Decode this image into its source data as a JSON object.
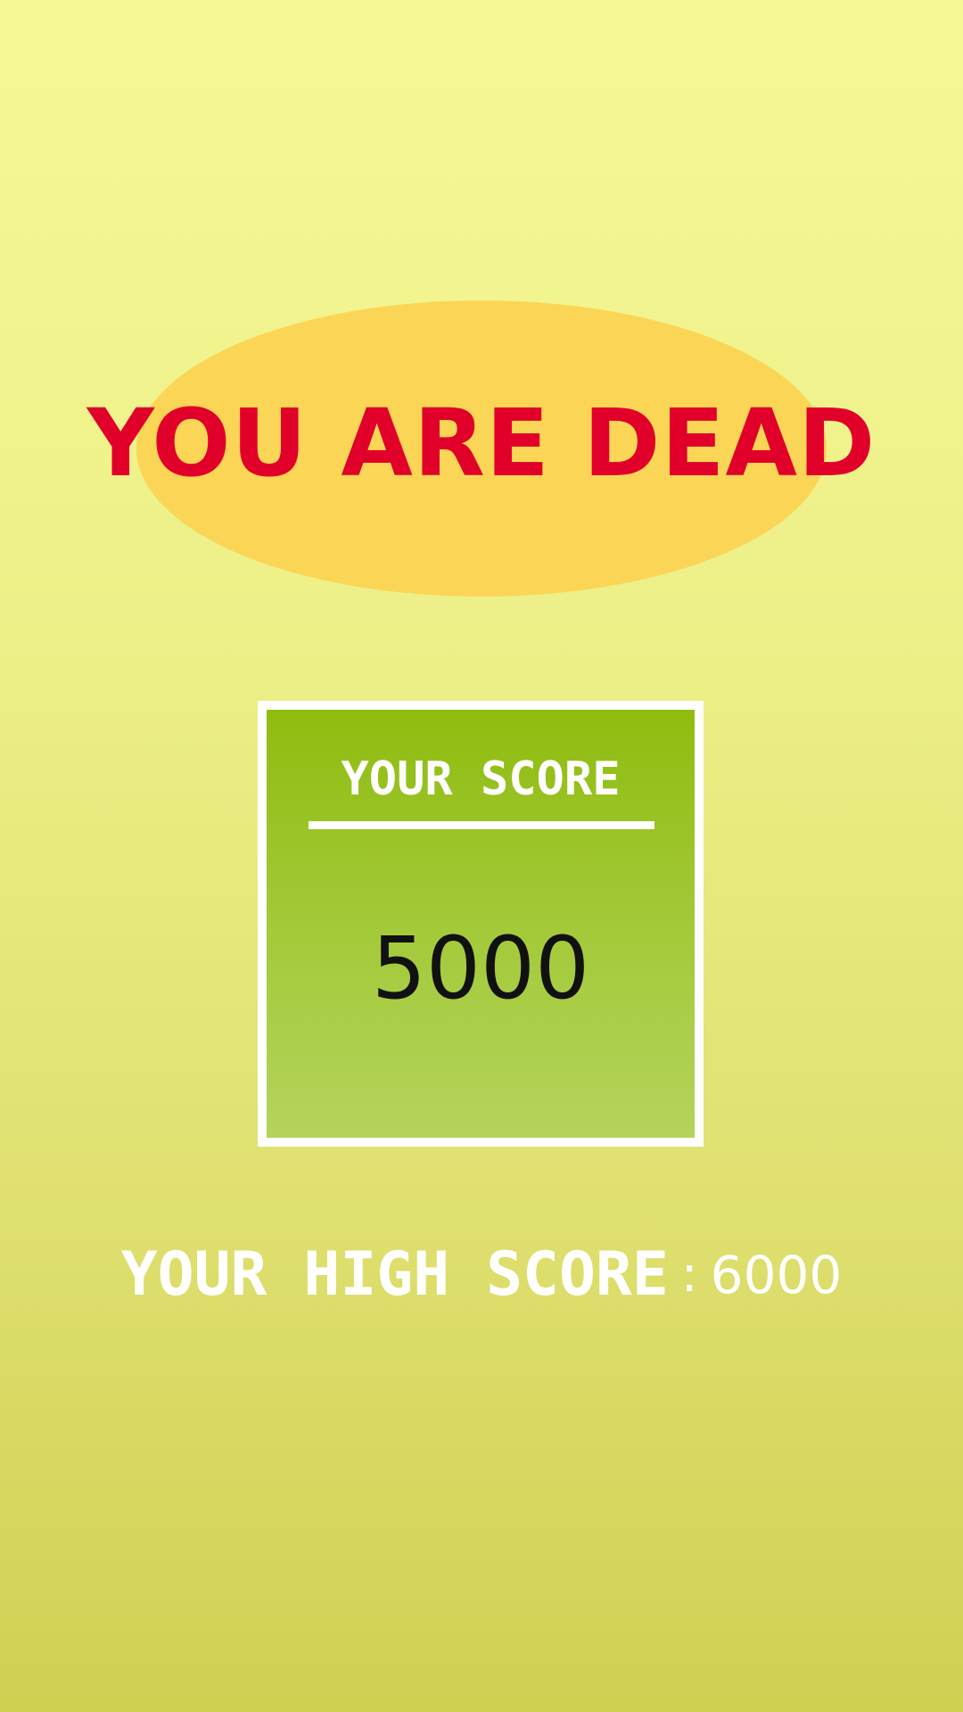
{
  "game_over": {
    "title": "YOU ARE DEAD",
    "title_color": "#e1002a",
    "oval_color": "#fbd555"
  },
  "score_panel": {
    "label": "YOUR SCORE",
    "value": "5000"
  },
  "high_score": {
    "label": "YOUR HIGH SCORE",
    "separator": ":",
    "value": "6000"
  }
}
